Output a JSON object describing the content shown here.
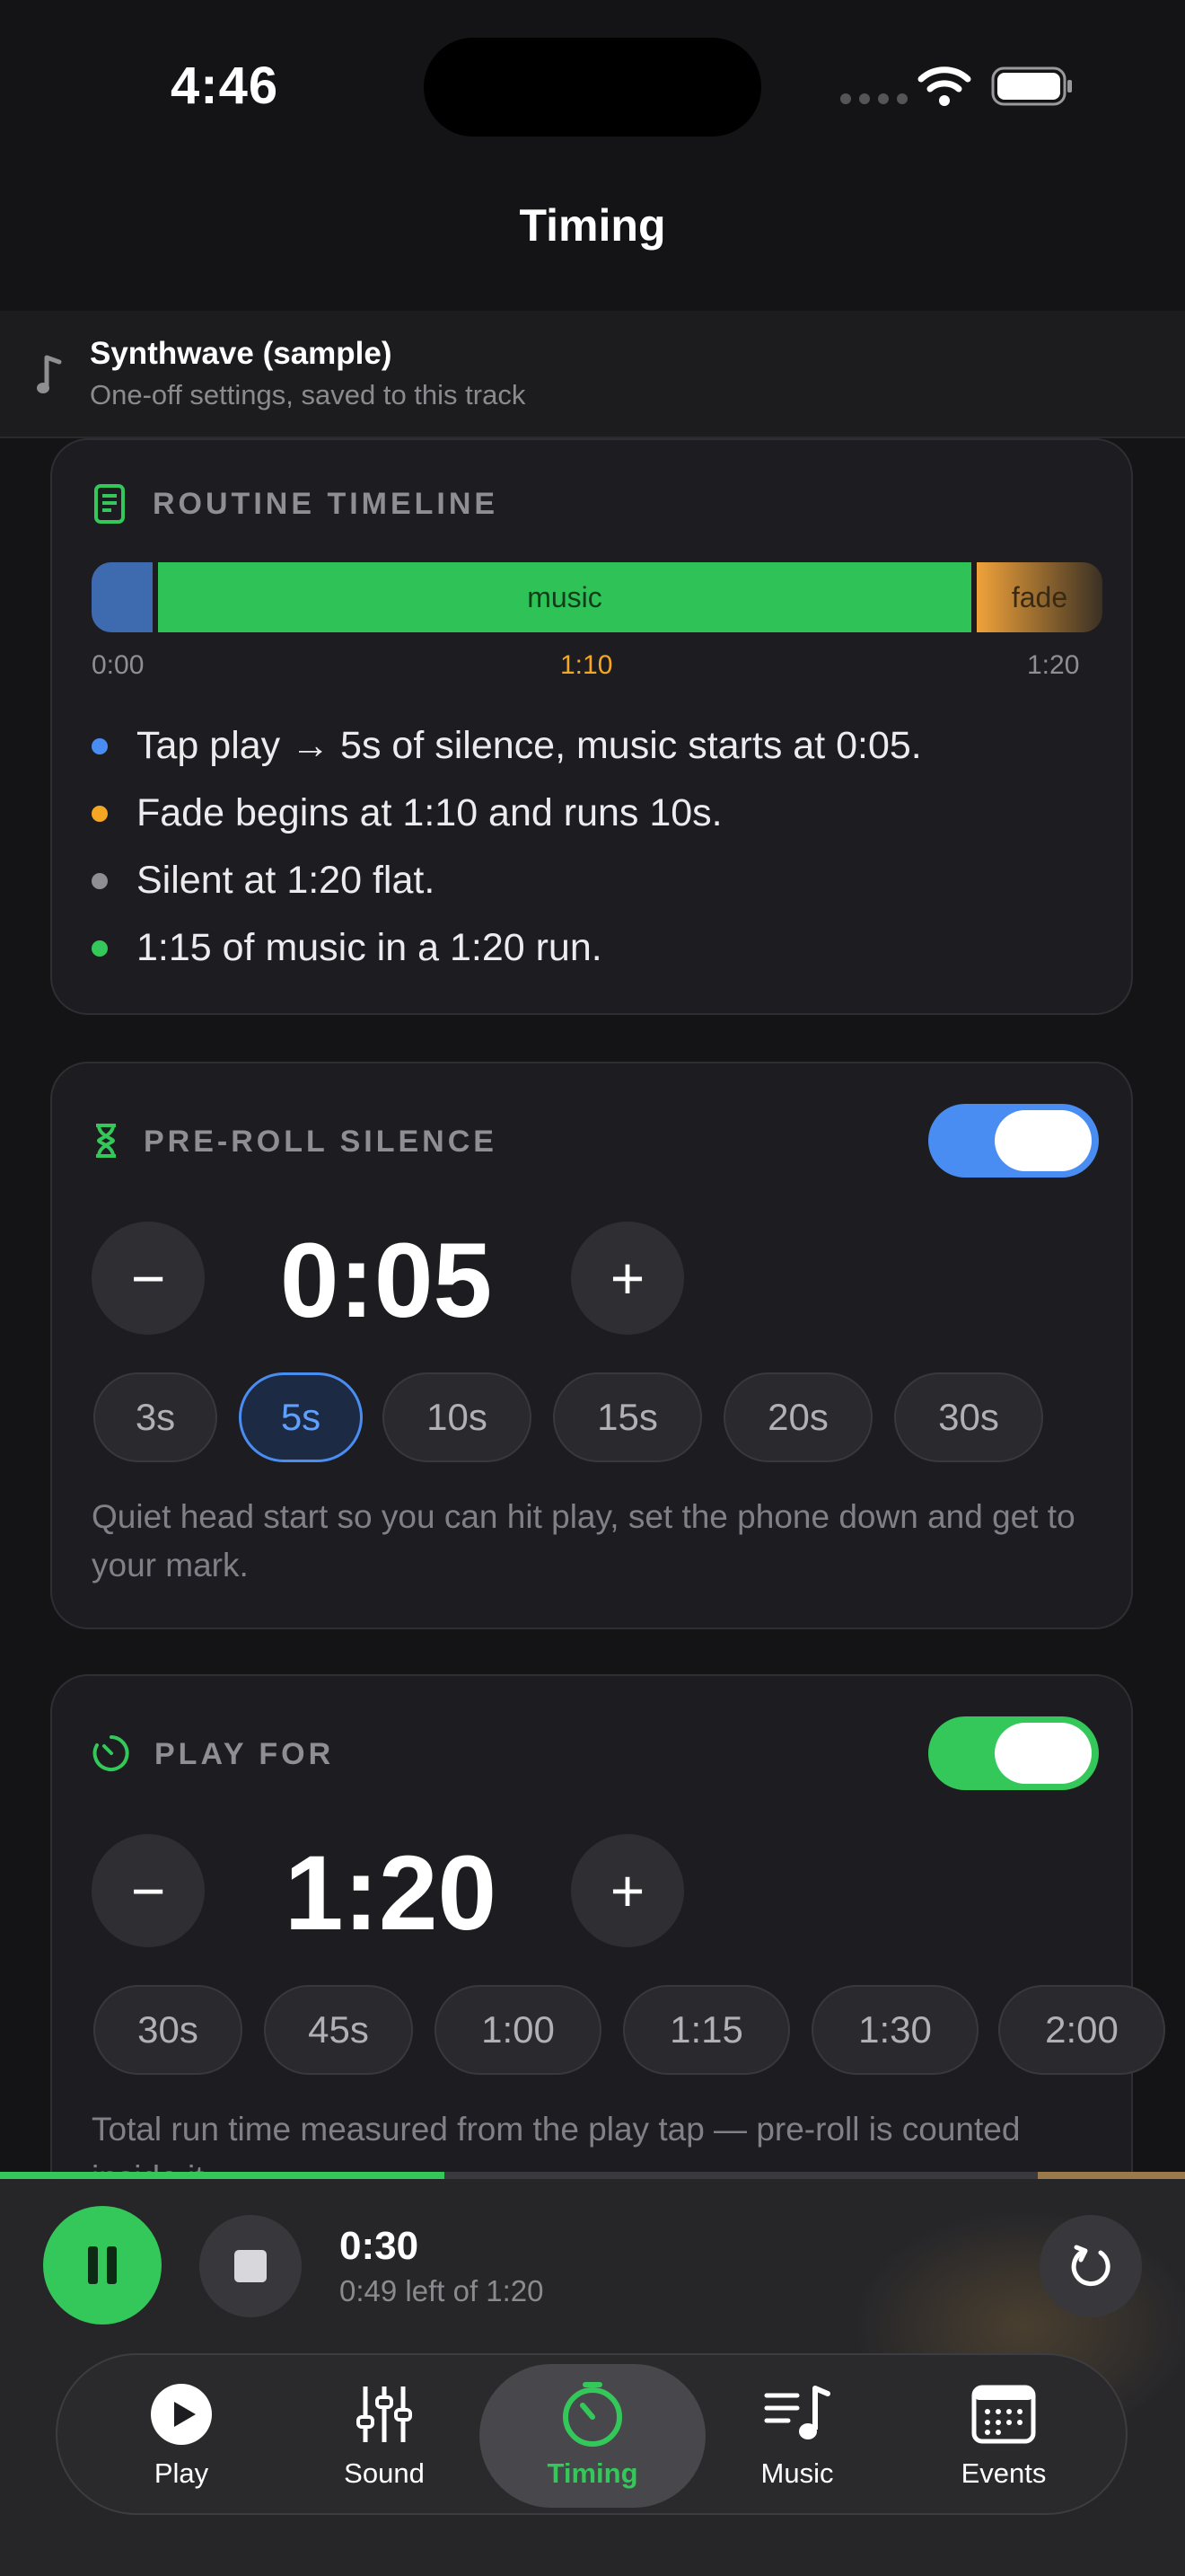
{
  "status_bar": {
    "time": "4:46"
  },
  "nav": {
    "title": "Timing"
  },
  "track": {
    "name": "Synthwave (sample)",
    "subtitle": "One-off settings, saved to this track"
  },
  "timeline_card": {
    "title": "ROUTINE TIMELINE",
    "segments": {
      "music": "music",
      "fade": "fade"
    },
    "labels": {
      "start": "0:00",
      "fade_start": "1:10",
      "end": "1:20"
    },
    "bullets": [
      "Tap play → 5s of silence, music starts at 0:05.",
      "Fade begins at 1:10 and runs 10s.",
      "Silent at 1:20 flat.",
      "1:15 of music in a 1:20 run."
    ]
  },
  "preroll_card": {
    "title": "PRE-ROLL SILENCE",
    "enabled": true,
    "value": "0:05",
    "minus": "−",
    "plus": "+",
    "chips": [
      "3s",
      "5s",
      "10s",
      "15s",
      "20s",
      "30s"
    ],
    "selected": "5s",
    "help": "Quiet head start so you can hit play, set the phone down and get to your mark."
  },
  "playfor_card": {
    "title": "PLAY FOR",
    "enabled": true,
    "value": "1:20",
    "minus": "−",
    "plus": "+",
    "chips": [
      "30s",
      "45s",
      "1:00",
      "1:15",
      "1:30",
      "2:00"
    ],
    "help": "Total run time measured from the play tap — pre-roll is counted inside it."
  },
  "player": {
    "elapsed": "0:30",
    "remaining": "0:49 left of 1:20",
    "progress": 0.375
  },
  "tabs": [
    {
      "label": "Play",
      "icon": "play-circle-icon",
      "active": false
    },
    {
      "label": "Sound",
      "icon": "sliders-icon",
      "active": false
    },
    {
      "label": "Timing",
      "icon": "timer-icon",
      "active": true
    },
    {
      "label": "Music",
      "icon": "music-list-icon",
      "active": false
    },
    {
      "label": "Events",
      "icon": "calendar-icon",
      "active": false
    }
  ],
  "colors": {
    "accent_green": "#34c759",
    "accent_blue": "#4a8df2",
    "fade_orange": "#f0a23a",
    "bg": "#141417"
  }
}
